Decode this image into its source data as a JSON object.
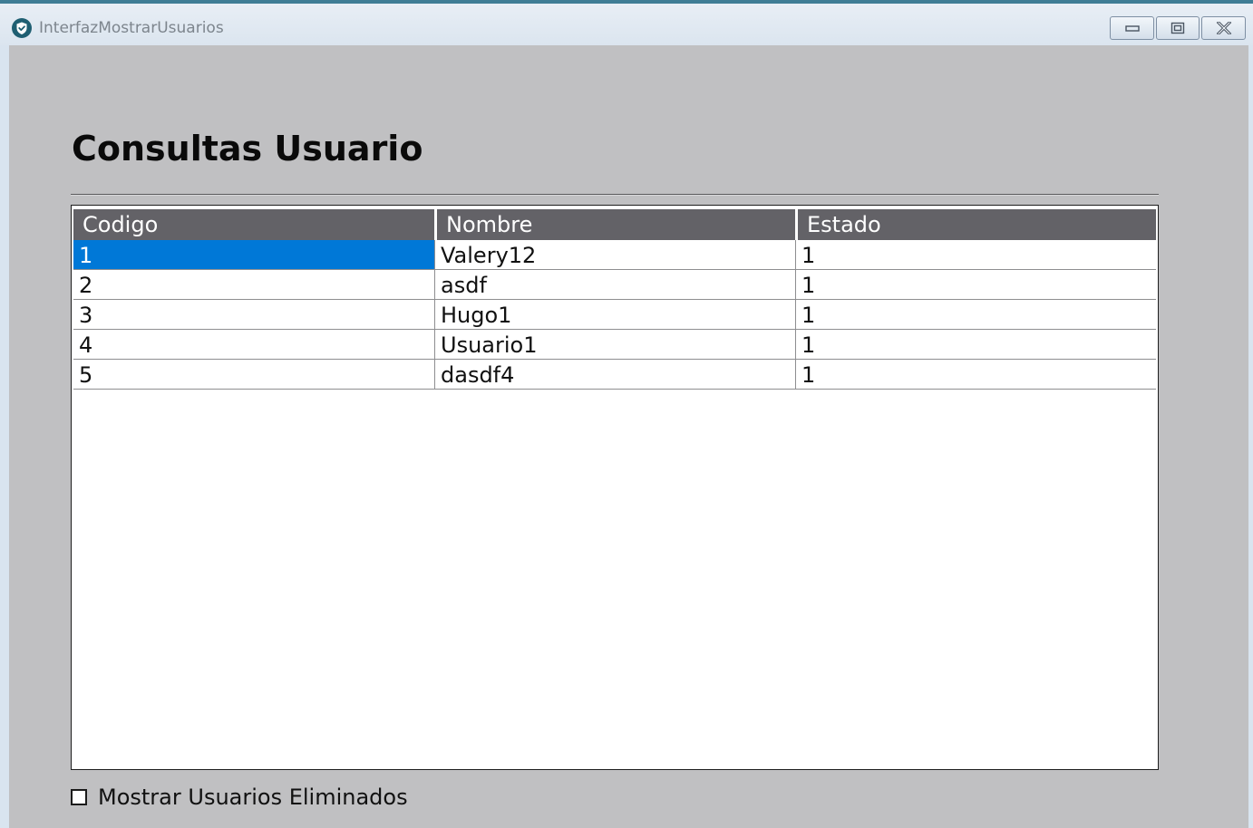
{
  "window": {
    "title": "InterfazMostrarUsuarios",
    "icon": "shield-check-icon",
    "controls": {
      "minimize_icon": "minimize-icon",
      "maximize_icon": "maximize-icon",
      "close_icon": "close-icon"
    }
  },
  "page": {
    "heading": "Consultas Usuario"
  },
  "table": {
    "columns": [
      "Codigo",
      "Nombre",
      "Estado"
    ],
    "rows": [
      [
        "1",
        "Valery12",
        "1"
      ],
      [
        "2",
        "asdf",
        "1"
      ],
      [
        "3",
        "Hugo1",
        "1"
      ],
      [
        "4",
        "Usuario1",
        "1"
      ],
      [
        "5",
        "dasdf4",
        "1"
      ]
    ],
    "selected_row": 0
  },
  "options": {
    "show_deleted_label": "Mostrar Usuarios Eliminados",
    "show_deleted_checked": false
  },
  "colors": {
    "header_bg": "#636267",
    "selection": "#0078d7",
    "content_bg": "#c0c0c2",
    "title_icon": "#1f5f72"
  }
}
